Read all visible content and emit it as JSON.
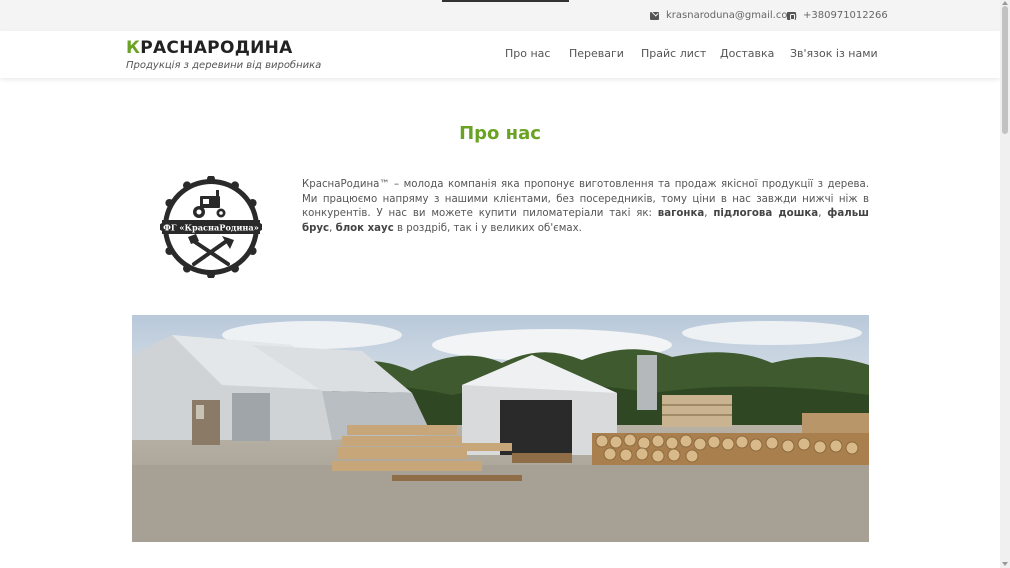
{
  "topbar": {
    "email": "krasnaroduna@gmail.com",
    "phone": "+380971012266"
  },
  "brand": {
    "name_first": "К",
    "name_rest": "РАСНАРОДИНА",
    "tagline": "Продукція з деревини від виробника"
  },
  "nav": {
    "items": [
      {
        "label": "Про нас"
      },
      {
        "label": "Переваги"
      },
      {
        "label": "Прайс лист"
      },
      {
        "label": "Доставка"
      },
      {
        "label": "Зв'язок із нами"
      }
    ]
  },
  "about": {
    "title": "Про нас",
    "logo_text": "ФГ «КраснаРодина»",
    "text_intro": "КраснаРодина™ – молода компанія яка пропонує виготовлення та продаж якісної продукції з дерева. Ми працюємо напряму з нашими клієнтами, без посередників, тому ціни в нас завжди нижчі ніж в конкурентів. У нас ви можете купити пиломатеріали такі як: ",
    "products": [
      "вагонка",
      "підлогова дошка",
      "фальш брус",
      "блок хаус"
    ],
    "sep": ", ",
    "text_outro": " в роздріб, так і у великих об'ємах."
  },
  "colors": {
    "accent": "#6aa323",
    "topbar_bg": "#f4f4f4"
  },
  "icons": {
    "email": "envelope-icon",
    "phone": "phone-icon"
  }
}
